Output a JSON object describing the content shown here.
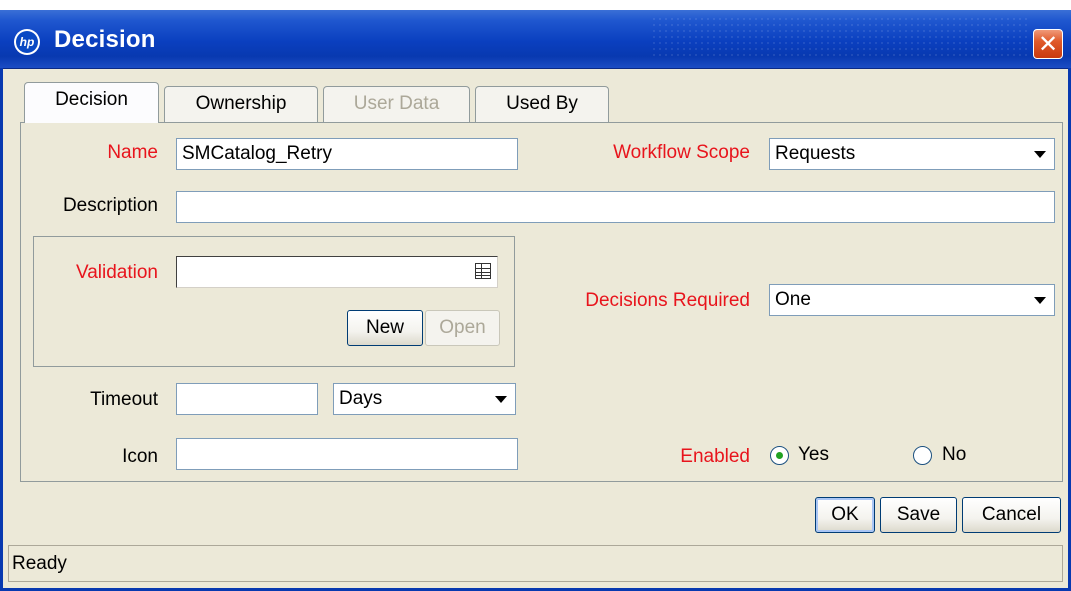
{
  "window": {
    "title": "Decision",
    "close_symbol": "✕",
    "logo_text": "hp"
  },
  "tabs": [
    {
      "label": "Decision",
      "active": true,
      "enabled": true
    },
    {
      "label": "Ownership",
      "active": false,
      "enabled": true
    },
    {
      "label": "User Data",
      "active": false,
      "enabled": false
    },
    {
      "label": "Used By",
      "active": false,
      "enabled": true
    }
  ],
  "form": {
    "name_label": "Name",
    "name_value": "SMCatalog_Retry",
    "workflow_scope_label": "Workflow Scope",
    "workflow_scope_value": "Requests",
    "description_label": "Description",
    "description_value": "",
    "validation_label": "Validation",
    "validation_value": "",
    "new_label": "New",
    "open_label": "Open",
    "decisions_required_label": "Decisions Required",
    "decisions_required_value": "One",
    "timeout_label": "Timeout",
    "timeout_value": "",
    "timeout_unit": "Days",
    "icon_label": "Icon",
    "icon_value": "",
    "enabled_label": "Enabled",
    "enabled_yes": "Yes",
    "enabled_no": "No",
    "enabled_selected": "Yes"
  },
  "buttons": {
    "ok": "OK",
    "save": "Save",
    "cancel": "Cancel"
  },
  "status": {
    "text": "Ready"
  },
  "colors": {
    "required_label": "#e8141c",
    "titlebar": "#0a3fbf",
    "background": "#ece9d8"
  }
}
